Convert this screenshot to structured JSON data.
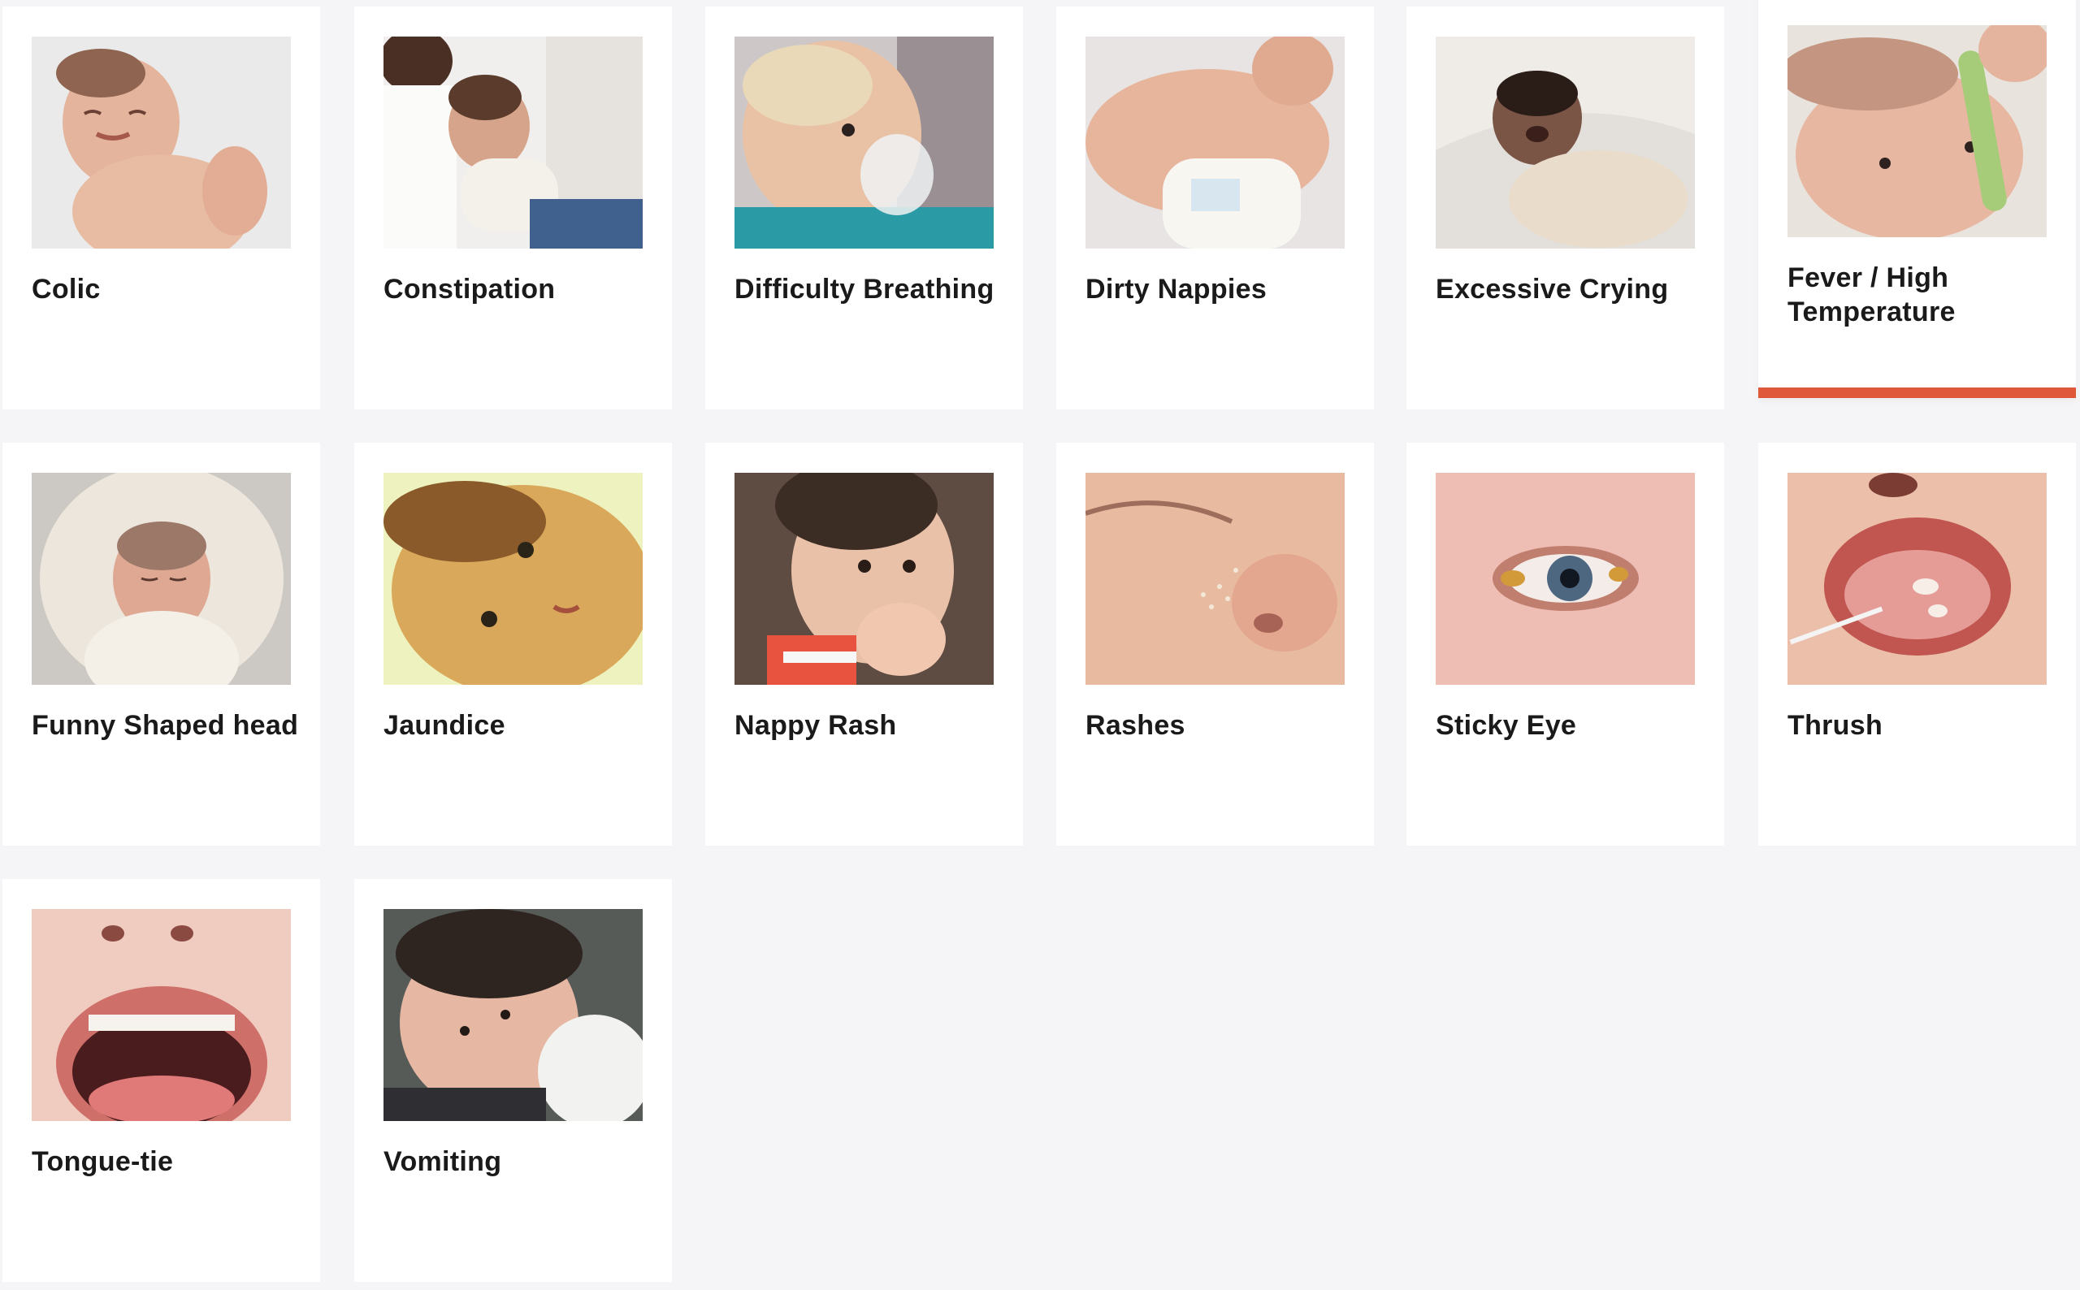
{
  "accent_color": "#e0583a",
  "active_card_index": 5,
  "cards": [
    {
      "label": "Colic",
      "icon": "crying-newborn-image"
    },
    {
      "label": "Constipation",
      "icon": "mother-holding-baby-image"
    },
    {
      "label": "Difficulty Breathing",
      "icon": "baby-nebuliser-mask-image"
    },
    {
      "label": "Dirty Nappies",
      "icon": "baby-in-nappy-image"
    },
    {
      "label": "Excessive Crying",
      "icon": "crying-baby-on-blanket-image"
    },
    {
      "label": "Fever / High Temperature",
      "icon": "baby-thermometer-image"
    },
    {
      "label": "Funny Shaped head",
      "icon": "swaddled-newborn-image"
    },
    {
      "label": "Jaundice",
      "icon": "jaundiced-baby-image"
    },
    {
      "label": "Nappy Rash",
      "icon": "baby-hand-in-mouth-image"
    },
    {
      "label": "Rashes",
      "icon": "baby-nose-rash-image"
    },
    {
      "label": "Sticky Eye",
      "icon": "baby-sticky-eye-image"
    },
    {
      "label": "Thrush",
      "icon": "baby-tongue-thrush-image"
    },
    {
      "label": "Tongue-tie",
      "icon": "open-mouth-tongue-image"
    },
    {
      "label": "Vomiting",
      "icon": "baby-on-shoulder-image"
    }
  ]
}
